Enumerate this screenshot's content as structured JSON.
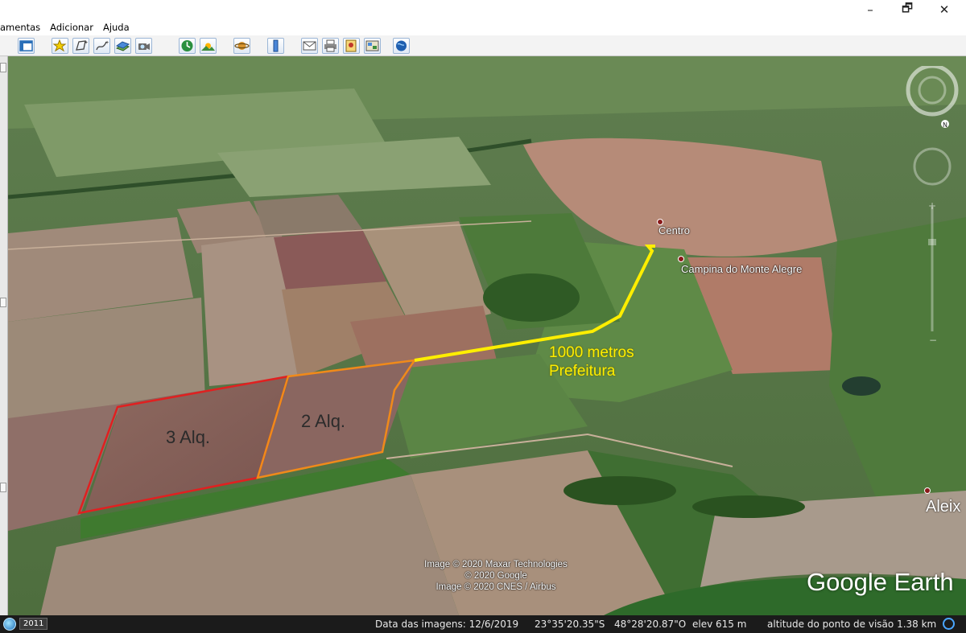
{
  "window": {
    "minimize_glyph": "–",
    "maximize_glyph": "🗗",
    "close_glyph": "✕"
  },
  "menu": {
    "items": [
      "amentas",
      "Adicionar",
      "Ajuda"
    ]
  },
  "toolbar": {
    "buttons": [
      "sidebar-toggle-icon",
      "placemark-icon",
      "polygon-icon",
      "path-icon",
      "image-overlay-icon",
      "record-tour-icon",
      "historical-imagery-icon",
      "sunlight-icon",
      "planets-icon",
      "ruler-icon",
      "email-icon",
      "print-icon",
      "save-image-icon",
      "view-in-maps-icon",
      "earth-view-icon"
    ]
  },
  "map": {
    "field_labels": [
      "3 Alq.",
      "2 Alq."
    ],
    "route_label_line1": "1000 metros",
    "route_label_line2": "Prefeitura",
    "places": {
      "centro": "Centro",
      "campina": "Campina do Monte Alegre",
      "aleix": "Aleix"
    },
    "copyright": [
      "Image © 2020 Maxar Technologies",
      "© 2020 Google",
      "Image © 2020 CNES / Airbus"
    ],
    "logo": "Google Earth",
    "colors": {
      "plot_3": "#e02020",
      "plot_2": "#f08a1a",
      "route": "#ffee00"
    }
  },
  "statusbar": {
    "year": "2011",
    "imagery_date": "Data das imagens: 12/6/2019",
    "latitude": "23°35'20.35\"S",
    "longitude": "48°28'20.87\"O",
    "elevation": "elev   615 m",
    "eye_altitude": "altitude do ponto de visão   1.38 km"
  }
}
